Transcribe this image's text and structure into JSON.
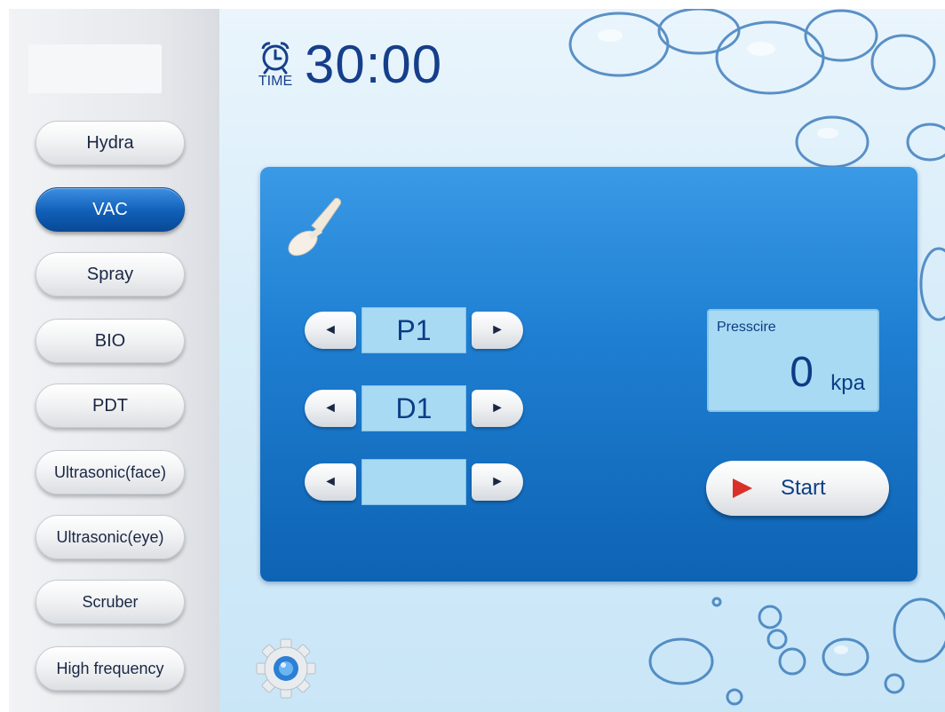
{
  "timer": {
    "value": "30:00",
    "caption": "TIME"
  },
  "sidebar": {
    "items": [
      {
        "label": "Hydra"
      },
      {
        "label": "VAC",
        "active": true
      },
      {
        "label": "Spray"
      },
      {
        "label": "BIO"
      },
      {
        "label": "PDT"
      },
      {
        "label": "Ultrasonic(face)"
      },
      {
        "label": "Ultrasonic(eye)"
      },
      {
        "label": "Scruber"
      },
      {
        "label": "High frequency"
      }
    ]
  },
  "panel": {
    "steppers": [
      {
        "value": "P1"
      },
      {
        "value": "D1"
      },
      {
        "value": ""
      }
    ],
    "pressure": {
      "label": "Presscire",
      "value": "0",
      "unit": "kpa"
    },
    "start_label": "Start"
  },
  "icons": {
    "clock": "alarm-clock-icon",
    "probe": "vacuum-probe-icon",
    "gear": "gear-icon",
    "left_arrow": "◄",
    "right_arrow": "►",
    "play": "play-icon"
  },
  "colors": {
    "accent": "#163f8a",
    "active_button": "#0f5fb8",
    "panel": "#1f7fd2",
    "display": "#a9daf3",
    "play": "#d9302a"
  }
}
